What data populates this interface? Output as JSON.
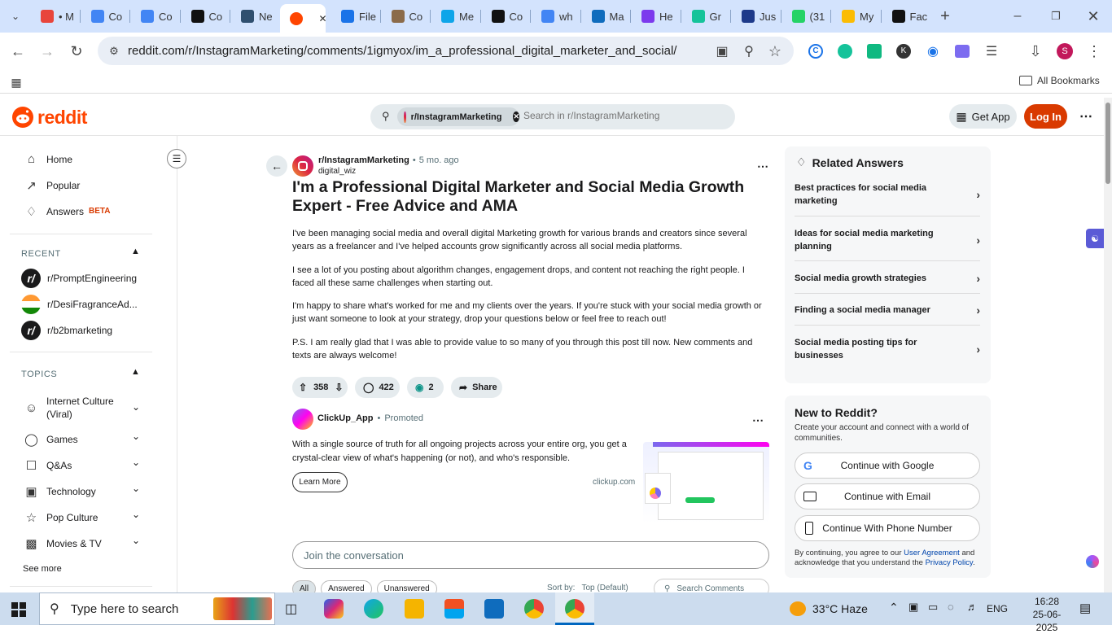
{
  "browser": {
    "tabs": [
      {
        "label": "• M",
        "color": "#e8453c"
      },
      {
        "label": "Co",
        "color": "#4285f4"
      },
      {
        "label": "Co",
        "color": "#4285f4"
      },
      {
        "label": "Co",
        "color": "#111111"
      },
      {
        "label": "Ne",
        "color": "#2f4f6f"
      },
      {
        "label": "",
        "color": "#ff4500",
        "active": true
      },
      {
        "label": "File",
        "color": "#1a73e8"
      },
      {
        "label": "Co",
        "color": "#8b6b4a"
      },
      {
        "label": "Me",
        "color": "#0ea5e9"
      },
      {
        "label": "Co",
        "color": "#111111"
      },
      {
        "label": "wh",
        "color": "#4285f4"
      },
      {
        "label": "Ma",
        "color": "#0f6cbd"
      },
      {
        "label": "He",
        "color": "#7c3aed"
      },
      {
        "label": "Gr",
        "color": "#15c39a"
      },
      {
        "label": "Jus",
        "color": "#1e3a8a"
      },
      {
        "label": "(31",
        "color": "#25d366"
      },
      {
        "label": "My",
        "color": "#fbbc04"
      },
      {
        "label": "Fac",
        "color": "#111111"
      }
    ],
    "url": "reddit.com/r/InstagramMarketing/comments/1igmyox/im_a_professional_digital_marketer_and_social/",
    "profile_initial": "S",
    "all_bookmarks": "All Bookmarks"
  },
  "reddit": {
    "logo_text": "reddit",
    "search_chip": "r/InstagramMarketing",
    "search_placeholder": "Search in r/InstagramMarketing",
    "get_app": "Get App",
    "login": "Log In",
    "accent": "#d93a00"
  },
  "leftnav": {
    "items": [
      {
        "label": "Home",
        "icon": "home-icon"
      },
      {
        "label": "Popular",
        "icon": "popular-icon"
      },
      {
        "label": "Answers",
        "badge": "BETA",
        "icon": "answers-icon"
      }
    ],
    "recent_header": "RECENT",
    "recent": [
      "r/PromptEngineering",
      "r/DesiFragranceAd...",
      "r/b2bmarketing"
    ],
    "topics_header": "TOPICS",
    "topics": [
      {
        "label": "Internet Culture (Viral)",
        "icon": "smile-icon"
      },
      {
        "label": "Games",
        "icon": "gamepad-icon"
      },
      {
        "label": "Q&As",
        "icon": "qa-icon"
      },
      {
        "label": "Technology",
        "icon": "chip-icon"
      },
      {
        "label": "Pop Culture",
        "icon": "star-icon"
      },
      {
        "label": "Movies & TV",
        "icon": "clapper-icon"
      }
    ],
    "see_more": "See more"
  },
  "post": {
    "subreddit": "r/InstagramMarketing",
    "age": "5 mo. ago",
    "author": "digital_wiz",
    "title": "I'm a Professional Digital Marketer and Social Media Growth Expert - Free Advice and AMA",
    "paragraphs": [
      "I've been managing social media and overall digital Marketing growth for various brands and creators since several years as a freelancer and I've helped accounts grow significantly across all social media platforms.",
      "I see a lot of you posting about algorithm changes, engagement drops, and content not reaching the right people. I faced all these same challenges when starting out.",
      "I'm happy to share what's worked for me and my clients over the years. If you're stuck with your social media growth or just want someone to look at your strategy, drop your questions below or feel free to reach out!",
      "P.S. I am really glad that I was able to provide value to so many of you through this post till now. New comments and texts are always welcome!"
    ],
    "votes": "358",
    "comments": "422",
    "awards": "2",
    "share": "Share"
  },
  "promo": {
    "name": "ClickUp_App",
    "tag": "Promoted",
    "text": "With a single source of truth for all ongoing projects across your entire org, you get a crystal-clear view of what's happening (or not), and who's responsible.",
    "cta": "Learn More",
    "domain": "clickup.com"
  },
  "conversation": {
    "placeholder": "Join the conversation",
    "filters": [
      "All",
      "Answered",
      "Unanswered"
    ],
    "sort_label": "Sort by:",
    "sort_value": "Top (Default)",
    "search_comments": "Search Comments"
  },
  "related": {
    "header": "Related Answers",
    "items": [
      "Best practices for social media marketing",
      "Ideas for social media marketing planning",
      "Social media growth strategies",
      "Finding a social media manager",
      "Social media posting tips for businesses"
    ]
  },
  "signup": {
    "header": "New to Reddit?",
    "sub": "Create your account and connect with a world of communities.",
    "google": "Continue with Google",
    "email": "Continue with Email",
    "phone": "Continue With Phone Number",
    "legal_1": "By continuing, you agree to our",
    "ua": "User Agreement",
    "legal_2": "and acknowledge that you understand the",
    "pp": "Privacy Policy",
    "legal_3": "."
  },
  "taskbar": {
    "search": "Type here to search",
    "weather": "33°C  Haze",
    "lang": "ENG",
    "time": "16:28",
    "date": "25-06-2025"
  }
}
